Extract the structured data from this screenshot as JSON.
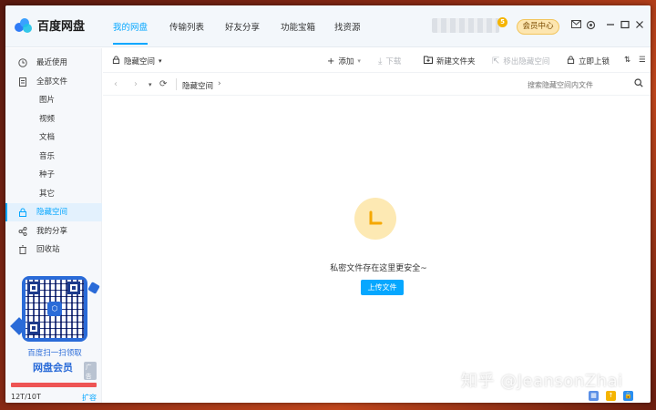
{
  "app": {
    "name": "百度网盘"
  },
  "nav_tabs": [
    {
      "label": "我的网盘",
      "active": true
    },
    {
      "label": "传输列表"
    },
    {
      "label": "好友分享"
    },
    {
      "label": "功能宝箱"
    },
    {
      "label": "找资源"
    }
  ],
  "header": {
    "vip_button": "会员中心",
    "coin_badge": "5"
  },
  "sidebar": {
    "items": [
      {
        "label": "最近使用",
        "icon": "clock-icon"
      },
      {
        "label": "全部文件",
        "icon": "file-icon"
      },
      {
        "label": "图片"
      },
      {
        "label": "视频"
      },
      {
        "label": "文档"
      },
      {
        "label": "音乐"
      },
      {
        "label": "种子"
      },
      {
        "label": "其它"
      },
      {
        "label": "隐藏空间",
        "icon": "lock-icon",
        "active": true
      },
      {
        "label": "我的分享",
        "icon": "share-icon"
      },
      {
        "label": "回收站",
        "icon": "trash-icon"
      }
    ],
    "promo": {
      "line1": "百度扫一扫领取",
      "line2": "网盘会员",
      "tag": "广告"
    },
    "storage": {
      "used_text": "12T/10T",
      "expand_label": "扩容"
    }
  },
  "toolbar": {
    "space_dropdown": "隐藏空间",
    "add": "添加",
    "download": "下载",
    "new_folder": "新建文件夹",
    "move_out": "移出隐藏空间",
    "lock_now": "立即上锁"
  },
  "pathbar": {
    "crumb": "隐藏空间",
    "search_placeholder": "搜索隐藏空间内文件"
  },
  "empty_state": {
    "message": "私密文件存在这里更安全~",
    "upload_button": "上传文件"
  },
  "watermark": "知乎 @JeansonZhai",
  "colors": {
    "accent": "#06a7ff",
    "vip": "#fde6b0",
    "storage_over": "#ee5454"
  }
}
